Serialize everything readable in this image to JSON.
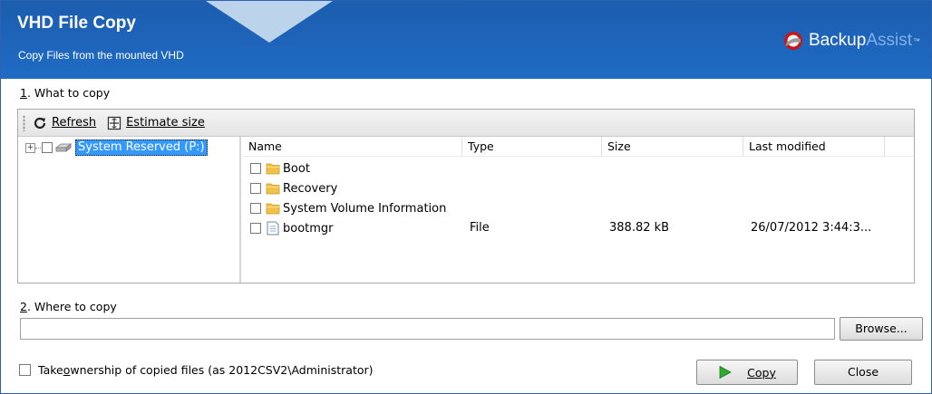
{
  "window": {
    "title": "VHD File Copy",
    "subtitle": "Copy Files from the mounted VHD"
  },
  "brand": {
    "part1": "Backup",
    "part2": "Assist",
    "tm": "™",
    "logo_icon": "backupassist-logo-icon"
  },
  "colors": {
    "header_blue": "#1f63b7",
    "selection_blue": "#3399ff",
    "brand_light_blue": "#7fb0ea",
    "copy_arrow_green": "#2eaa2e",
    "folder_yellow": "#f0c24a"
  },
  "what_to_copy": {
    "number": "1",
    "label": ". What to copy",
    "toolbar": {
      "refresh_label": "Refresh",
      "refresh_icon": "refresh-icon",
      "estimate_label": "Estimate size",
      "estimate_icon": "estimate-size-icon"
    },
    "tree": {
      "expander": "+",
      "drive_label": "System Reserved (P:)"
    },
    "list": {
      "columns": [
        "Name",
        "Type",
        "Size",
        "Last modified"
      ],
      "rows": [
        {
          "name": "Boot",
          "type": "",
          "size": "",
          "modified": "",
          "icon": "folder-icon"
        },
        {
          "name": "Recovery",
          "type": "",
          "size": "",
          "modified": "",
          "icon": "folder-icon"
        },
        {
          "name": "System Volume Information",
          "type": "",
          "size": "",
          "modified": "",
          "icon": "folder-icon"
        },
        {
          "name": "bootmgr",
          "type": "File",
          "size": "388.82 kB",
          "modified": "26/07/2012 3:44:3...",
          "icon": "file-icon"
        }
      ]
    }
  },
  "where_to_copy": {
    "number": "2",
    "label": ". Where to copy",
    "value": "",
    "browse_label": "Browse..."
  },
  "ownership": {
    "prefix": "Take ",
    "accel": "o",
    "suffix": "wnership of copied files (as 2012CSV2\\Administrator)",
    "checked": false
  },
  "buttons": {
    "copy_label": "Copy",
    "copy_icon": "play-arrow-icon",
    "close_label": "Close"
  }
}
